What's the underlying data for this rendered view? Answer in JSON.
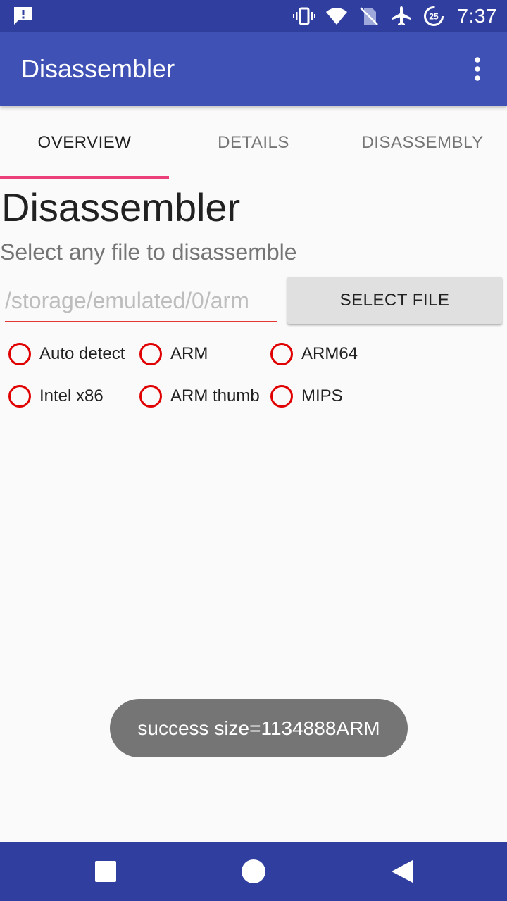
{
  "status_bar": {
    "time": "7:37",
    "battery_level": "25",
    "icons": [
      "alert-notification-icon",
      "vibrate-icon",
      "wifi-icon",
      "no-sim-icon",
      "airplane-mode-icon",
      "battery-saver-icon"
    ]
  },
  "app_bar": {
    "title": "Disassembler",
    "menu_icon": "more-vert-icon"
  },
  "tabs": [
    {
      "label": "OVERVIEW",
      "active": true
    },
    {
      "label": "DETAILS",
      "active": false
    },
    {
      "label": "DISASSEMBLY",
      "active": false
    }
  ],
  "main": {
    "headline": "Disassembler",
    "subtitle": "Select any file to disassemble",
    "file_path_value": "/storage/emulated/0/arm",
    "select_file_label": "SELECT FILE",
    "architectures": [
      {
        "label": "Auto detect",
        "checked": false
      },
      {
        "label": "ARM",
        "checked": false
      },
      {
        "label": "ARM64",
        "checked": false
      },
      {
        "label": "Intel x86",
        "checked": false
      },
      {
        "label": "ARM thumb",
        "checked": false
      },
      {
        "label": "MIPS",
        "checked": false
      }
    ]
  },
  "toast": {
    "message": "success size=1134888ARM"
  },
  "nav_bar": {
    "buttons": [
      "recents-icon",
      "home-icon",
      "back-icon"
    ]
  },
  "colors": {
    "status_bar": "#303f9f",
    "app_bar": "#3f51b5",
    "tab_indicator": "#ec407a",
    "radio_accent": "#e00000",
    "field_underline": "#e53935"
  }
}
